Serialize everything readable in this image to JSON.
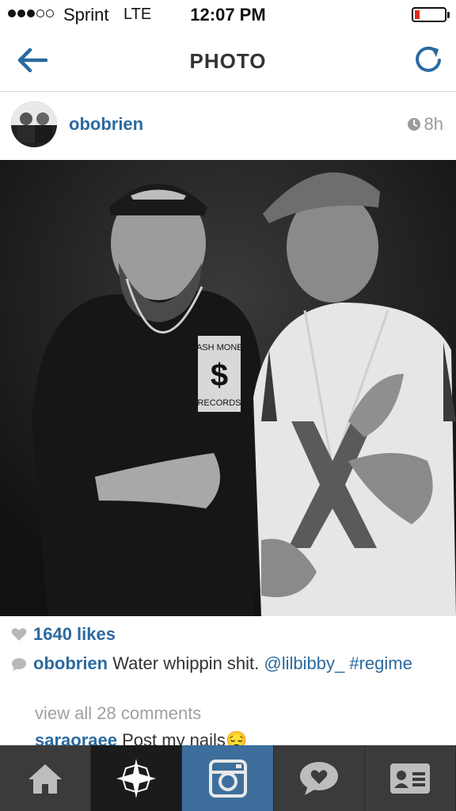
{
  "status_bar": {
    "carrier": "Sprint",
    "network": "LTE",
    "time": "12:07 PM",
    "signal_bars_filled": 3,
    "signal_bars_total": 5,
    "battery_level": 0.12,
    "battery_color": "#e0271e"
  },
  "nav": {
    "title": "PHOTO",
    "back_icon": "back-arrow-icon",
    "refresh_icon": "refresh-icon"
  },
  "post": {
    "username": "obobrien",
    "time_ago": "8h",
    "likes": "1640 likes",
    "caption": {
      "user": "obobrien",
      "text": "Water whippin shit.",
      "mention": "@lilbibby_",
      "hashtag": "#regime"
    },
    "view_all_comments": "view all 28 comments",
    "comment": {
      "user": "saraoraee",
      "text": "Post my nails",
      "emoji": "😔"
    },
    "photo_text": {
      "shirt_top": "CASH MONEY",
      "shirt_symbol": "$",
      "shirt_bottom": "RECORDS"
    }
  },
  "tab_bar": {
    "tabs": [
      {
        "name": "home",
        "icon": "home-icon"
      },
      {
        "name": "explore",
        "icon": "explore-star-icon"
      },
      {
        "name": "camera",
        "icon": "camera-icon",
        "active": true
      },
      {
        "name": "activity",
        "icon": "heart-bubble-icon"
      },
      {
        "name": "profile",
        "icon": "profile-card-icon"
      }
    ]
  },
  "colors": {
    "link_blue": "#2b6aa0",
    "tab_bar_bg": "#3b3b3b",
    "tab_active_bg": "#3d6e9c",
    "muted_gray": "#9a9a9a"
  }
}
